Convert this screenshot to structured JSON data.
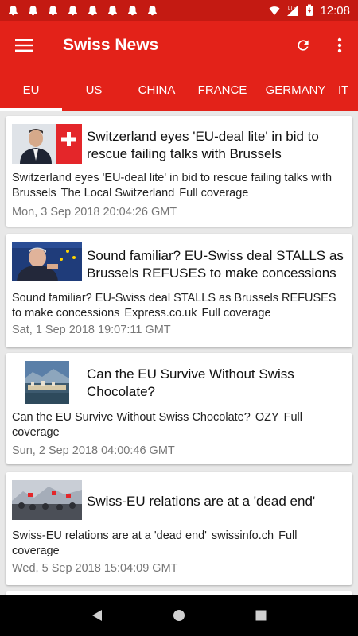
{
  "status_bar": {
    "time": "12:08",
    "network": "LTE",
    "notification_count": 8
  },
  "app_bar": {
    "title": "Swiss News",
    "menu_icon": "hamburger-menu-icon",
    "refresh_icon": "refresh-icon",
    "overflow_icon": "more-vert-icon"
  },
  "tabs": [
    {
      "label": "EU",
      "active": true
    },
    {
      "label": "US",
      "active": false
    },
    {
      "label": "CHINA",
      "active": false
    },
    {
      "label": "FRANCE",
      "active": false
    },
    {
      "label": "GERMANY",
      "active": false
    },
    {
      "label": "IT",
      "active": false
    }
  ],
  "articles": [
    {
      "title": "Switzerland eyes 'EU-deal lite' in bid to rescue failing talks with Brussels",
      "summary": "Switzerland eyes 'EU-deal lite' in bid to rescue failing talks with Brussels",
      "source": "The Local Switzerland",
      "coverage": "Full coverage",
      "date": "Mon, 3 Sep 2018 20:04:26 GMT"
    },
    {
      "title": "Sound familiar? EU-Swiss deal STALLS as Brussels REFUSES to make concessions",
      "summary": "Sound familiar? EU-Swiss deal STALLS as Brussels REFUSES to make concessions",
      "source": "Express.co.uk",
      "coverage": "Full coverage",
      "date": "Sat, 1 Sep 2018 19:07:11 GMT"
    },
    {
      "title": "Can the EU Survive Without Swiss Chocolate?",
      "summary": "Can the EU Survive Without Swiss Chocolate?",
      "source": "OZY",
      "coverage": "Full coverage",
      "date": "Sun, 2 Sep 2018 04:00:46 GMT"
    },
    {
      "title": "Swiss-EU relations are at a 'dead end'",
      "summary": "Swiss-EU relations are at a 'dead end'",
      "source": "swissinfo.ch",
      "coverage": "Full coverage",
      "date": "Wed, 5 Sep 2018 15:04:09 GMT"
    }
  ],
  "colors": {
    "primary": "#e32219",
    "status_bar": "#c41a12",
    "background": "#e8e8e8"
  }
}
